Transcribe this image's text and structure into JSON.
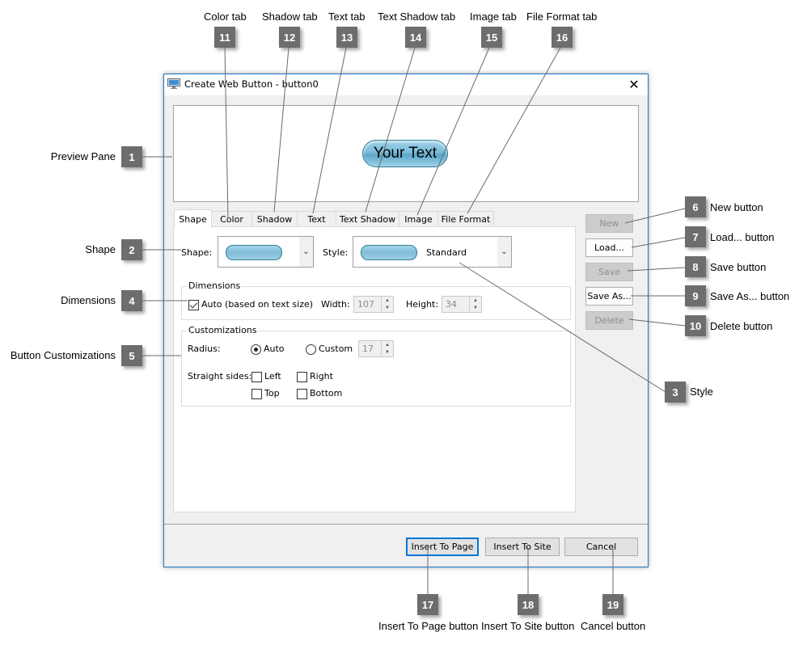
{
  "dialog": {
    "title": "Create Web Button - button0",
    "close_symbol": "✕",
    "preview": {
      "button_text": "Your Text"
    },
    "tabs": [
      {
        "label": "Shape",
        "active": true
      },
      {
        "label": "Color",
        "active": false
      },
      {
        "label": "Shadow",
        "active": false
      },
      {
        "label": "Text",
        "active": false
      },
      {
        "label": "Text Shadow",
        "active": false
      },
      {
        "label": "Image",
        "active": false
      },
      {
        "label": "File Format",
        "active": false
      }
    ],
    "shape_panel": {
      "shape_label": "Shape:",
      "style_label": "Style:",
      "style_value": "Standard",
      "dropdown_symbol": "⌄",
      "dimensions": {
        "title": "Dimensions",
        "auto_label": "Auto (based on text size)",
        "auto_checked": true,
        "width_label": "Width:",
        "width_value": "107",
        "height_label": "Height:",
        "height_value": "34"
      },
      "customizations": {
        "title": "Customizations",
        "radius_label": "Radius:",
        "radius_auto_label": "Auto",
        "radius_custom_label": "Custom",
        "radius_selected": "Auto",
        "radius_value": "17",
        "straight_sides_label": "Straight sides:",
        "sides": [
          {
            "label": "Left",
            "checked": false
          },
          {
            "label": "Right",
            "checked": false
          },
          {
            "label": "Top",
            "checked": false
          },
          {
            "label": "Bottom",
            "checked": false
          }
        ]
      }
    },
    "side_buttons": [
      {
        "label": "New",
        "enabled": false
      },
      {
        "label": "Load...",
        "enabled": true
      },
      {
        "label": "Save",
        "enabled": false
      },
      {
        "label": "Save As...",
        "enabled": true
      },
      {
        "label": "Delete",
        "enabled": false
      }
    ],
    "footer_buttons": [
      {
        "label": "Insert To Page",
        "default": true
      },
      {
        "label": "Insert To Site",
        "default": false
      },
      {
        "label": "Cancel",
        "default": false
      }
    ]
  },
  "callouts": [
    {
      "number": "1",
      "label": "Preview Pane"
    },
    {
      "number": "2",
      "label": "Shape"
    },
    {
      "number": "3",
      "label": "Style"
    },
    {
      "number": "4",
      "label": "Dimensions"
    },
    {
      "number": "5",
      "label": "Button Customizations"
    },
    {
      "number": "6",
      "label": "New button"
    },
    {
      "number": "7",
      "label": "Load... button"
    },
    {
      "number": "8",
      "label": "Save button"
    },
    {
      "number": "9",
      "label": "Save As... button"
    },
    {
      "number": "10",
      "label": "Delete button"
    },
    {
      "number": "11",
      "label": "Color tab"
    },
    {
      "number": "12",
      "label": "Shadow tab"
    },
    {
      "number": "13",
      "label": "Text tab"
    },
    {
      "number": "14",
      "label": "Text Shadow tab"
    },
    {
      "number": "15",
      "label": "Image tab"
    },
    {
      "number": "16",
      "label": "File Format tab"
    },
    {
      "number": "17",
      "label": "Insert To Page button"
    },
    {
      "number": "18",
      "label": "Insert To Site button"
    },
    {
      "number": "19",
      "label": "Cancel button"
    }
  ],
  "colors": {
    "window_border": "#1979ca",
    "badge": "#6d6d6d",
    "default_button_border": "#0078d7",
    "pill_accent": "#5aa6c7"
  }
}
